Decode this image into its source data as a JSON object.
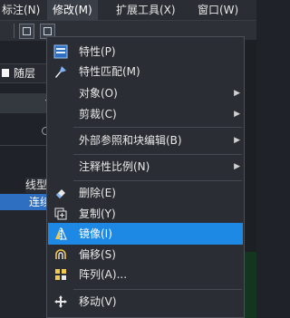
{
  "menubar": {
    "items": [
      {
        "label": "标注(N)"
      },
      {
        "label": "修改(M)"
      },
      {
        "label": "扩展工具(X)"
      },
      {
        "label": "窗口(W)"
      }
    ]
  },
  "layer": {
    "name": "随层"
  },
  "properties": {
    "linetype_header": "线型",
    "linetype_value": "连续"
  },
  "modify_menu": {
    "items": [
      {
        "label": "特性(P)",
        "icon": "properties-icon"
      },
      {
        "label": "特性匹配(M)",
        "icon": "match-properties-brush-icon"
      },
      {
        "label": "对象(O)",
        "submenu": true
      },
      {
        "label": "剪裁(C)",
        "submenu": true
      },
      {
        "label": "外部参照和块编辑(B)",
        "submenu": true
      },
      {
        "label": "注释性比例(N)",
        "submenu": true
      },
      {
        "label": "删除(E)",
        "icon": "eraser-icon"
      },
      {
        "label": "复制(Y)",
        "icon": "copy-icon"
      },
      {
        "label": "镜像(I)",
        "icon": "mirror-icon",
        "highlighted": true
      },
      {
        "label": "偏移(S)",
        "icon": "offset-icon"
      },
      {
        "label": "阵列(A)...",
        "icon": "array-icon"
      },
      {
        "label": "移动(V)",
        "icon": "move-icon"
      }
    ]
  },
  "colors": {
    "highlight": "#1e88e5",
    "menu_bg": "#2a2d33",
    "selected_row": "#2f6fc2"
  }
}
